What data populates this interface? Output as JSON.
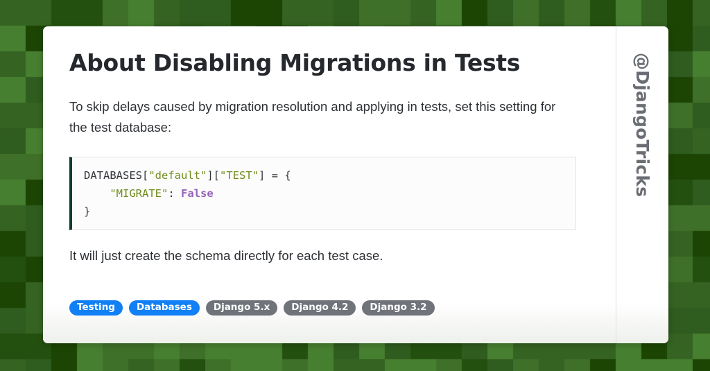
{
  "background": {
    "name": "checkered-green-pattern",
    "tile_size": 37,
    "colors": [
      "#3f7029",
      "#477f30",
      "#2f5c1f",
      "#1c4504",
      "#356322",
      "#24500f"
    ]
  },
  "card": {
    "title": "About Disabling Migrations in Tests",
    "intro_paragraph": "To skip delays caused by migration resolution and applying in tests, set this setting for the test database:",
    "outro_paragraph": "It will just create the schema directly for each test case.",
    "code": {
      "language": "python",
      "lines": [
        [
          {
            "t": "DATABASES[",
            "c": "punc"
          },
          {
            "t": "\"default\"",
            "c": "str"
          },
          {
            "t": "][",
            "c": "punc"
          },
          {
            "t": "\"TEST\"",
            "c": "str"
          },
          {
            "t": "] = {",
            "c": "punc"
          }
        ],
        [
          {
            "t": "    ",
            "c": "punc"
          },
          {
            "t": "\"MIGRATE\"",
            "c": "str"
          },
          {
            "t": ": ",
            "c": "punc"
          },
          {
            "t": "False",
            "c": "kw"
          }
        ],
        [
          {
            "t": "}",
            "c": "punc"
          }
        ]
      ],
      "accent_color": "#123d2d",
      "string_color": "#6f8c1c",
      "keyword_color": "#9561b8"
    },
    "tags": [
      {
        "label": "Testing",
        "style": "blue"
      },
      {
        "label": "Databases",
        "style": "blue"
      },
      {
        "label": "Django 5.x",
        "style": "gray"
      },
      {
        "label": "Django 4.2",
        "style": "gray"
      },
      {
        "label": "Django 3.2",
        "style": "gray"
      }
    ],
    "tag_colors": {
      "blue": "#1180f5",
      "gray": "#70747a"
    },
    "watermark": "@DjangoTricks"
  }
}
